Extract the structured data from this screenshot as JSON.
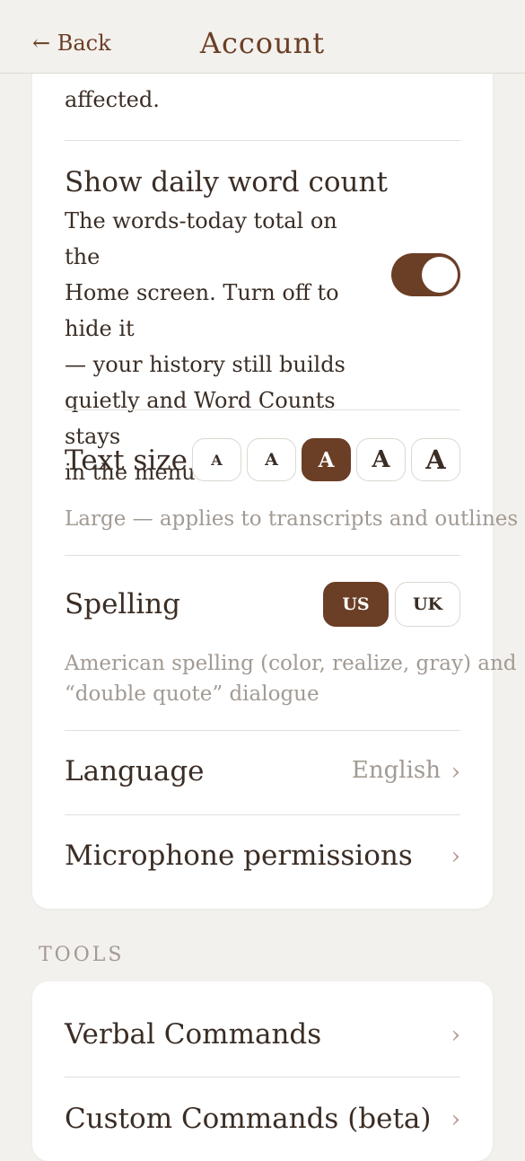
{
  "header": {
    "back_label": "← Back",
    "title": "Account"
  },
  "account": {
    "prev_desc_tail": "affected.",
    "daily_word_count": {
      "title": "Show daily word count",
      "description_lines": [
        "The words-today total on the",
        "Home screen. Turn off to hide it",
        "— your history still builds",
        "quietly and Word Counts stays",
        "in the menu."
      ],
      "enabled": true
    },
    "text_size": {
      "title": "Text size",
      "options": [
        "A",
        "A",
        "A",
        "A",
        "A"
      ],
      "selected_index": 2,
      "caption": "Large — applies to transcripts and outlines"
    },
    "spelling": {
      "title": "Spelling",
      "options": [
        "US",
        "UK"
      ],
      "selected": "US",
      "caption_lines": [
        "American spelling (color, realize, gray) and",
        "“double quote” dialogue"
      ]
    },
    "language": {
      "title": "Language",
      "value": "English",
      "chevron": "›"
    },
    "microphone": {
      "title": "Microphone permissions",
      "chevron": "›"
    }
  },
  "tools": {
    "section_label": "TOOLS",
    "items": [
      {
        "label": "Verbal Commands",
        "chevron": "›"
      },
      {
        "label": "Custom Commands (beta)",
        "chevron": "›"
      }
    ]
  },
  "colors": {
    "accent": "#6b3e26",
    "background": "#f3f1ed",
    "muted_text": "#a29a93"
  }
}
